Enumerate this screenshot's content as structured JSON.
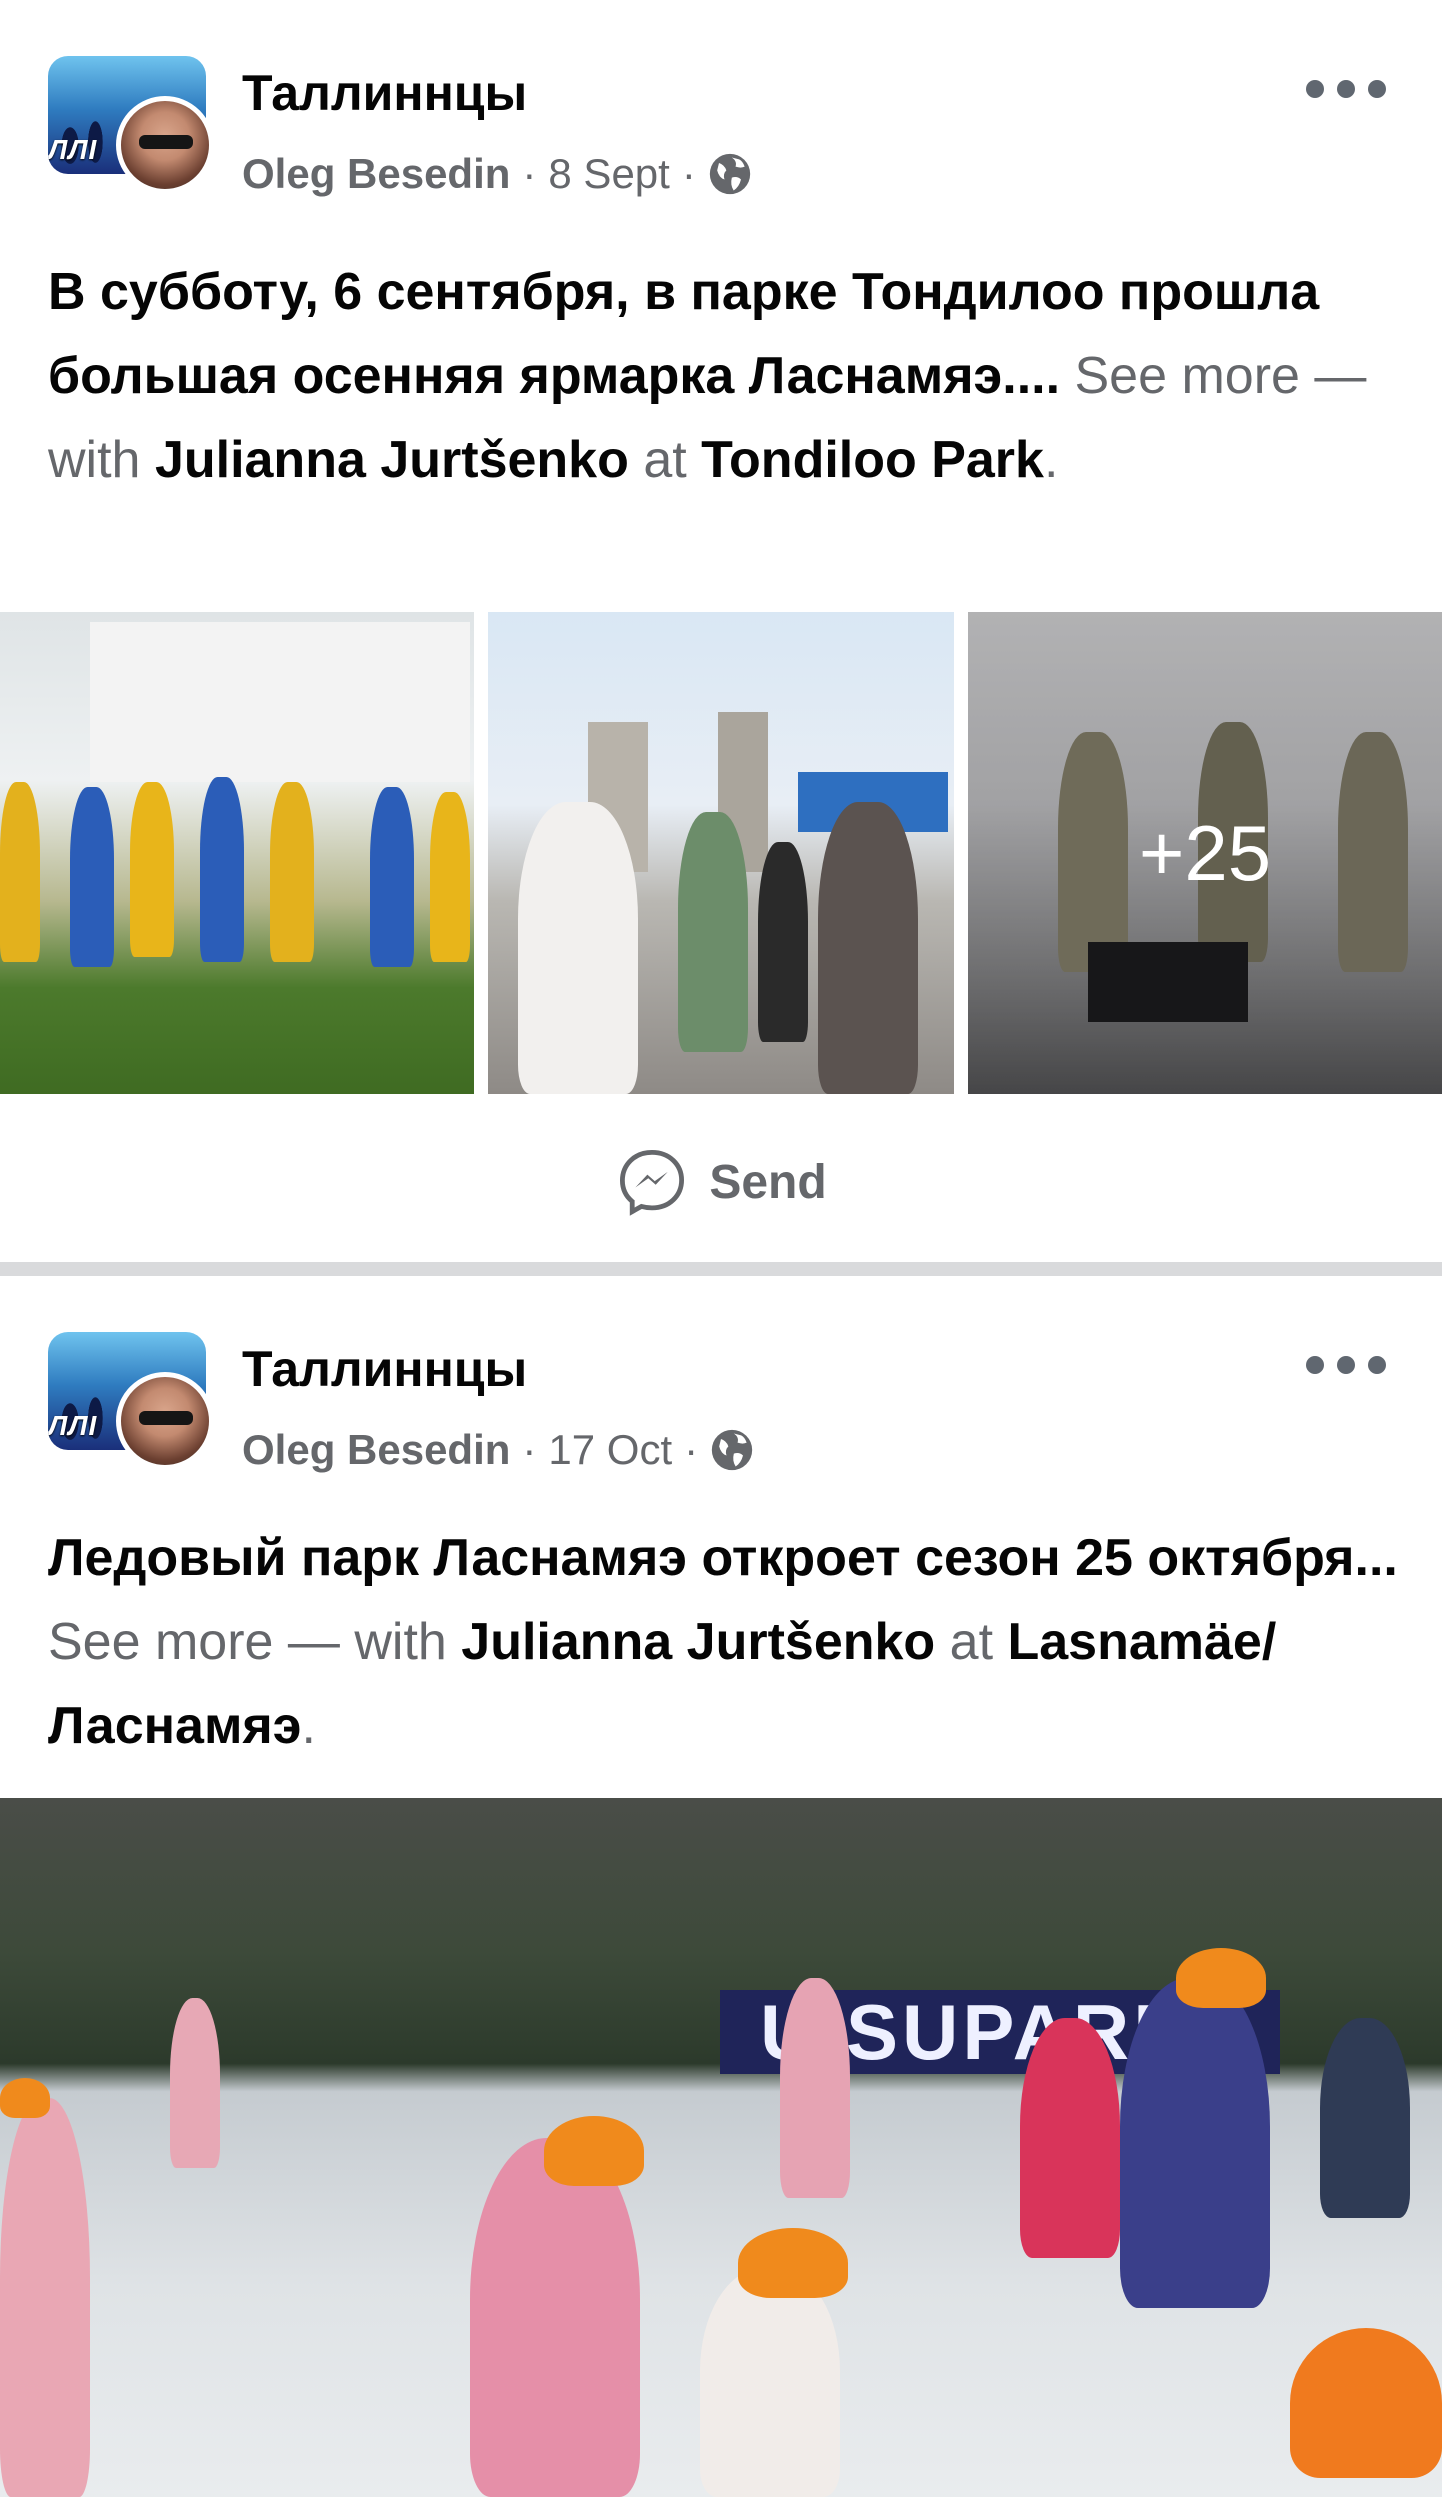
{
  "posts": [
    {
      "group_name": "Таллиннцы",
      "group_avatar_text": "ЛЛI",
      "author": "Oleg Besedin",
      "date": "8 Sept",
      "separator": "·",
      "text_main": "В субботу, 6 сентября, в парке Тондилоо прошла большая осенняя ярмарка Ласнамяэ....",
      "see_more": "See more",
      "with_text": "— with",
      "tagged_person": "Julianna Jurtšenko",
      "at_text": "at",
      "location": "Tondiloo Park",
      "period": ".",
      "extra_photos": "+25",
      "send_label": "Send"
    },
    {
      "group_name": "Таллиннцы",
      "group_avatar_text": "ЛЛI",
      "author": "Oleg Besedin",
      "date": "17 Oct",
      "separator": "·",
      "text_main": "Ледовый парк Ласнамяэ откроет сезон 25 октября...",
      "see_more": "See more",
      "with_text": "— with",
      "tagged_person": "Julianna Jurtšenko",
      "at_text": "at",
      "location": "Lasnamäe/Ласнамяэ",
      "period": ".",
      "sign_text": "UISUPARK"
    }
  ],
  "icons": {
    "more": "more-horizontal-icon",
    "privacy": "globe-icon",
    "send": "messenger-icon"
  },
  "colors": {
    "text": "#050505",
    "secondary": "#65676b",
    "separator": "#d9dadc",
    "helmet": "#f08a1c"
  }
}
